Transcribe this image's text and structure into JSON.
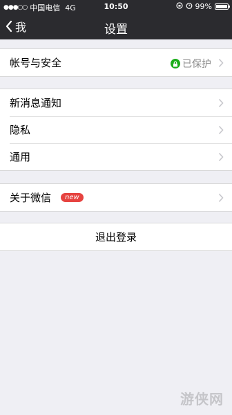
{
  "status_bar": {
    "signal": "●●●○○",
    "carrier": "中国电信",
    "network": "4G",
    "time": "10:50",
    "battery": "99%",
    "battery_level": 0.99
  },
  "nav": {
    "back_label": "我",
    "title": "设置"
  },
  "groups": {
    "account": {
      "label": "帐号与安全",
      "value": "已保护"
    },
    "notifications": {
      "label": "新消息通知"
    },
    "privacy": {
      "label": "隐私"
    },
    "general": {
      "label": "通用"
    },
    "about": {
      "label": "关于微信",
      "badge": "new"
    }
  },
  "logout_label": "退出登录",
  "watermark": "游侠网",
  "colors": {
    "nav_bg": "#2b2b2f",
    "page_bg": "#efeff4",
    "protected_green": "#1aad19",
    "badge_red": "#e64340"
  }
}
